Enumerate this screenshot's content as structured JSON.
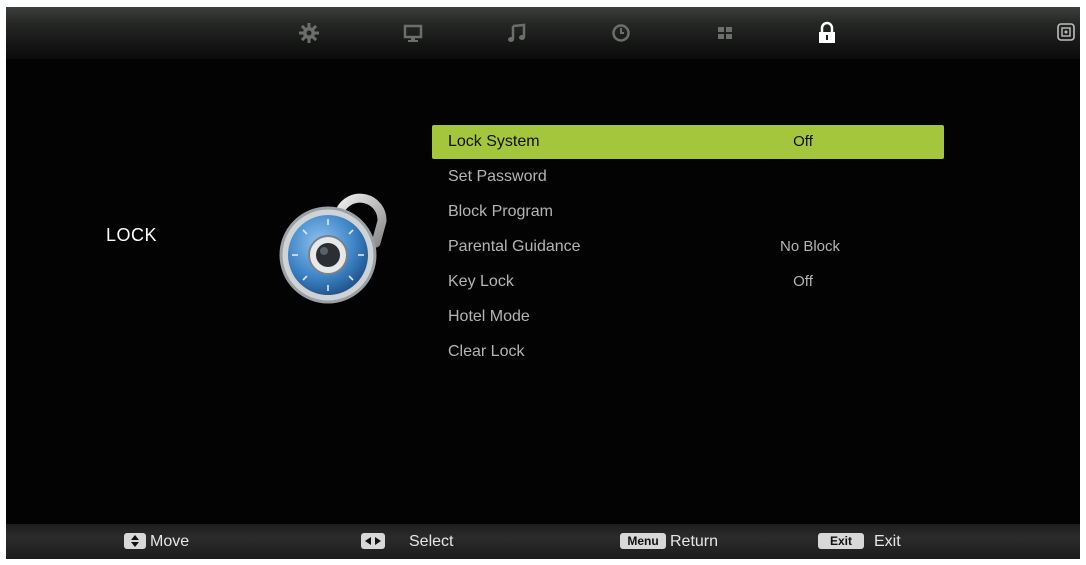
{
  "top_menu": {
    "icons": [
      "settings-icon",
      "picture-icon",
      "sound-icon",
      "time-icon",
      "apps-icon",
      "lock-icon",
      "input-source-icon"
    ],
    "active": "lock-icon",
    "accent_color": "#a3c63c"
  },
  "section": {
    "title": "LOCK",
    "icon": "padlock-icon"
  },
  "menu": {
    "items": [
      {
        "label": "Lock System",
        "value": "Off"
      },
      {
        "label": "Set Password",
        "value": ""
      },
      {
        "label": "Block Program",
        "value": ""
      },
      {
        "label": "Parental Guidance",
        "value": "No Block"
      },
      {
        "label": "Key Lock",
        "value": "Off"
      },
      {
        "label": "Hotel Mode",
        "value": ""
      },
      {
        "label": "Clear Lock",
        "value": ""
      }
    ],
    "selected_index": 0
  },
  "hints": {
    "move": {
      "key": "",
      "label": "Move"
    },
    "select": {
      "key": "",
      "label": "Select"
    },
    "return": {
      "key": "Menu",
      "label": "Return"
    },
    "exit": {
      "key": "Exit",
      "label": "Exit"
    }
  }
}
